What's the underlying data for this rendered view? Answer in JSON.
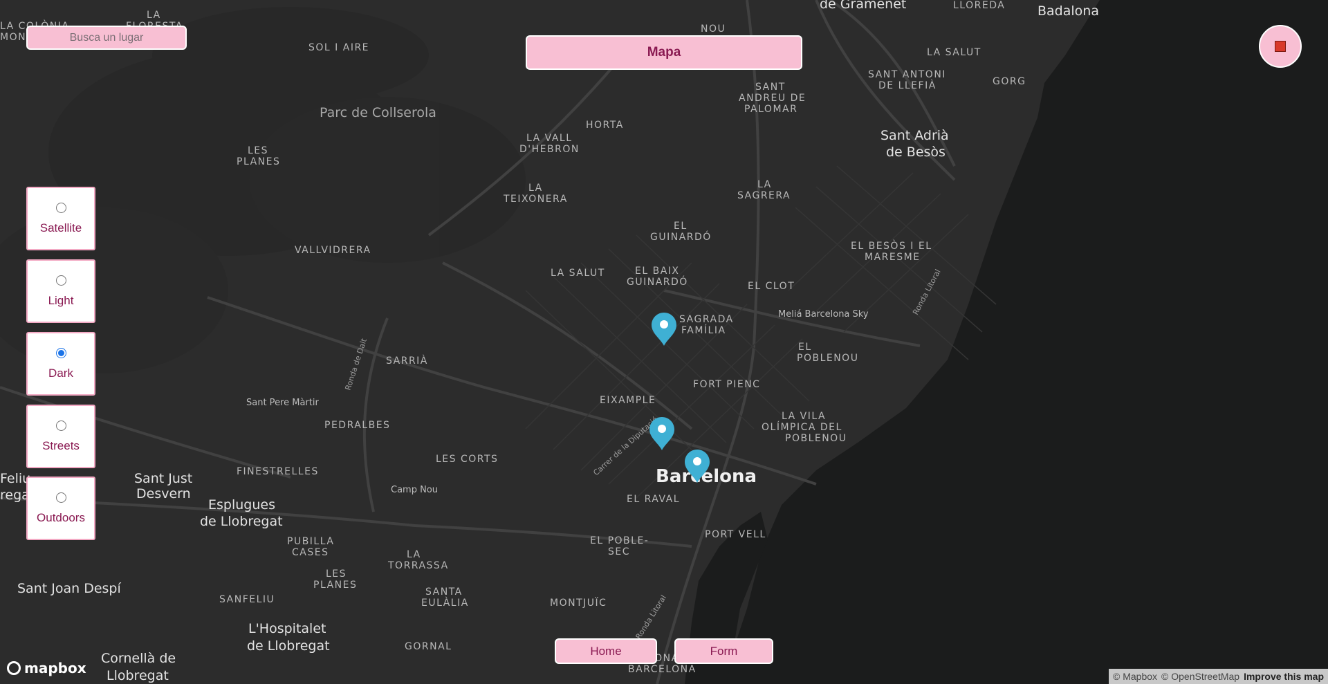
{
  "search": {
    "placeholder": "Busca un lugar"
  },
  "header": {
    "title": "Mapa"
  },
  "style_options": [
    {
      "label": "Satellite",
      "checked": false
    },
    {
      "label": "Light",
      "checked": false
    },
    {
      "label": "Dark",
      "checked": true
    },
    {
      "label": "Streets",
      "checked": false
    },
    {
      "label": "Outdoors",
      "checked": false
    }
  ],
  "nav": {
    "home_label": "Home",
    "form_label": "Form"
  },
  "logo": {
    "text": "mapbox"
  },
  "attribution": {
    "mapbox": "© Mapbox",
    "osm": "© OpenStreetMap",
    "improve": "Improve this map"
  },
  "map": {
    "labels": {
      "gramenet": "de Gramenet",
      "lloreda": "LLOREDA",
      "badalona": "Badalona",
      "la_florida": "LA",
      "la_florida_2": "FLORESTA",
      "la_colonia": "LA COLÒNIA",
      "montserrat": "MONTSERRAT",
      "nou": "NOU",
      "la_salut_badalona": "LA SALUT",
      "sol_i_aire": "SOL I AIRE",
      "sant_antoni": "SANT ANTONI",
      "de_llefia": "DE LLEFIÀ",
      "gorg": "GORG",
      "sant_andreu": "SANT",
      "sant_andreu_2": "ANDREU DE",
      "sant_andreu_3": "PALOMAR",
      "parc": "Parc de Collserola",
      "horta": "HORTA",
      "sant_adria": "Sant Adrià",
      "de_besos": "de Besòs",
      "les_planes_1": "LES",
      "les_planes_2": "PLANES",
      "la_vall": "LA VALL",
      "d_hebron": "D'HEBRON",
      "la_teixonera_1": "LA",
      "la_teixonera_2": "TEIXONERA",
      "la_sagrera_1": "LA",
      "la_sagrera_2": "SAGRERA",
      "el_guinardo_1": "EL",
      "el_guinardo_2": "GUINARDÓ",
      "el_besos_1": "EL BESÒS I EL",
      "el_besos_2": "MARESME",
      "vallvidrera": "VALLVIDRERA",
      "la_salut": "LA SALUT",
      "el_baix_1": "EL BAIX",
      "el_baix_2": "GUINARDÓ",
      "el_clot": "EL CLOT",
      "ronda_litoral_1": "Ronda Litoral",
      "sagrada_1": "SAGRADA",
      "sagrada_2": "FAMÍLIA",
      "melia": "Meliá Barcelona Sky",
      "el_poblenou_1": "EL",
      "el_poblenou_2": "POBLENOU",
      "ronda_dalt": "Ronda de Dalt",
      "sarria": "SARRIÀ",
      "fort_pienc": "FORT PIENC",
      "sant_pere": "Sant Pere Màrtir",
      "eixample": "EIXAMPLE",
      "pedralbes": "PEDRALBES",
      "la_vila_1": "LA VILA",
      "la_vila_2": "OLÍMPICA DEL",
      "la_vila_3": "POBLENOU",
      "carrer_diputacio": "Carrer de la Diputació",
      "feliu_1": "Feliu",
      "feliu_2": "regat",
      "sant_just_1": "Sant Just",
      "sant_just_2": "Desvern",
      "finestrelles": "FINESTRELLES",
      "les_corts": "LES CORTS",
      "barcelona": "Barcelona",
      "camp_nou": "Camp Nou",
      "esplugues_1": "Esplugues",
      "esplugues_2": "de Llobregat",
      "el_raval": "EL RAVAL",
      "pubilla_1": "PUBILLA",
      "pubilla_2": "CASES",
      "port_vell": "PORT VELL",
      "el_poble_sec_1": "EL POBLE-",
      "el_poble_sec_2": "SEC",
      "la_torrassa_1": "LA",
      "la_torrassa_2": "TORRASSA",
      "les_planes_h_1": "LES",
      "les_planes_h_2": "PLANES",
      "sant_joan": "Sant Joan Despí",
      "santa_eulalia_1": "SANTA",
      "santa_eulalia_2": "EULÀLIA",
      "sanfeliu": "SANFELIU",
      "montjuic": "MONTJUÏC",
      "hospitalet_1": "L'Hospitalet",
      "hospitalet_2": "de Llobregat",
      "ronda_litoral_2": "Ronda Litoral",
      "gornal": "GORNAL",
      "cornella_1": "Cornellà de",
      "cornella_2": "Llobregat",
      "zf_1": "ZONA FRANCA",
      "zf_2": "BARCELONA"
    },
    "colors": {
      "land": "#2b2b2b",
      "water": "#1b1c1c",
      "road": "#3d3d3d",
      "marker": "#3fb0d4"
    }
  }
}
